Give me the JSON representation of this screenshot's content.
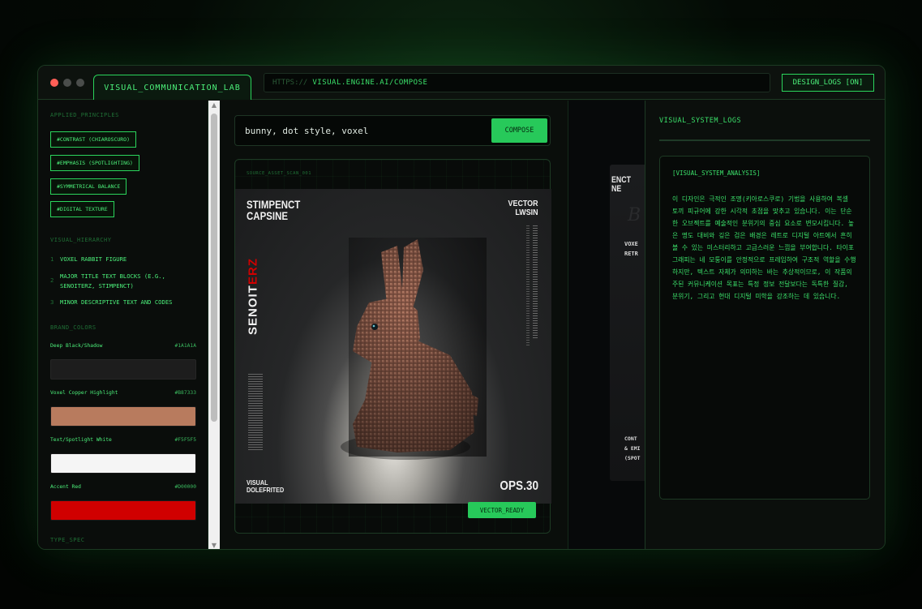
{
  "window": {
    "tab_label": "VISUAL_COMMUNICATION_LAB",
    "url_protocol": "HTTPS://",
    "url_host": "VISUAL.ENGINE.AI/COMPOSE",
    "logs_button": "DESIGN_LOGS [ON]"
  },
  "sidebar": {
    "principles_title": "APPLIED_PRINCIPLES",
    "principles": [
      "#CONTRAST (CHIAROSCURO)",
      "#EMPHASIS (SPOTLIGHTING)",
      "#SYMMETRICAL BALANCE",
      "#DIGITAL TEXTURE"
    ],
    "hierarchy_title": "VISUAL_HIERARCHY",
    "hierarchy": [
      {
        "num": "1",
        "text": "VOXEL RABBIT FIGURE"
      },
      {
        "num": "2",
        "text": "MAJOR TITLE TEXT BLOCKS (E.G., SENOITERZ, STIMPENCT)"
      },
      {
        "num": "3",
        "text": "MINOR DESCRIPTIVE TEXT AND CODES"
      }
    ],
    "colors_title": "BRAND_COLORS",
    "colors": [
      {
        "name": "Deep Black/Shadow",
        "hex": "#1A1A1A",
        "color": "#1A1A1A"
      },
      {
        "name": "Voxel Copper Highlight",
        "hex": "#B87333",
        "color": "#B87B5E"
      },
      {
        "name": "Text/Spotlight White",
        "hex": "#F5F5F5",
        "color": "#F5F5F5"
      },
      {
        "name": "Accent Red",
        "hex": "#D00000",
        "color": "#D00000"
      }
    ],
    "type_title": "TYPE_SPEC"
  },
  "composer": {
    "prompt": "bunny, dot style, voxel",
    "compose_label": "COMPOSE",
    "frame_label": "SOURCE_ASSET_SCAN_001",
    "ready_label": "VECTOR_READY"
  },
  "poster": {
    "title_left_1": "STIMPENCT",
    "title_left_2": "CAPSINE",
    "title_right_1": "VECTOR",
    "title_right_2": "LWSIN",
    "vertical_white": "SENOIT",
    "vertical_red": "ERZ",
    "bottom_left_1": "VISUAL",
    "bottom_left_2": "DOLEFRITED",
    "bottom_right": "OPS.30"
  },
  "ghost_card": {
    "title_1": "ENCT",
    "title_2": "NE",
    "text_1": "VOXE",
    "text_2": "RETR",
    "text_3": "CONT",
    "text_4": "& EMI",
    "text_5": "(SPOT",
    "letter": "B"
  },
  "logs": {
    "title": "VISUAL_SYSTEM_LOGS",
    "header": "[VISUAL_SYSTEM_ANALYSIS]",
    "body": "이 디자인은 극적인 조명(키아로스쿠로) 기법을 사용하여 복셀 토끼 피규어에 강한 시각적 초점을 맞추고 있습니다. 이는 단순한 오브젝트를 예술적인 분위기의 중심 요소로 변모시킵니다. 높은 명도 대비와 깊은 검은 배경은 레트로 디지털 아트에서 흔히 볼 수 있는 미스터리하고 고급스러운 느낌을 부여합니다. 타이포그래피는 네 모퉁이를 안정적으로 프레임하여 구조적 역할을 수행하지만, 텍스트 자체가 의미하는 바는 추상적이므로, 이 작품의 주된 커뮤니케이션 목표는 특정 정보 전달보다는 독특한 질감, 분위기, 그리고 현대 디지털 미학을 강조하는 데 있습니다."
  }
}
